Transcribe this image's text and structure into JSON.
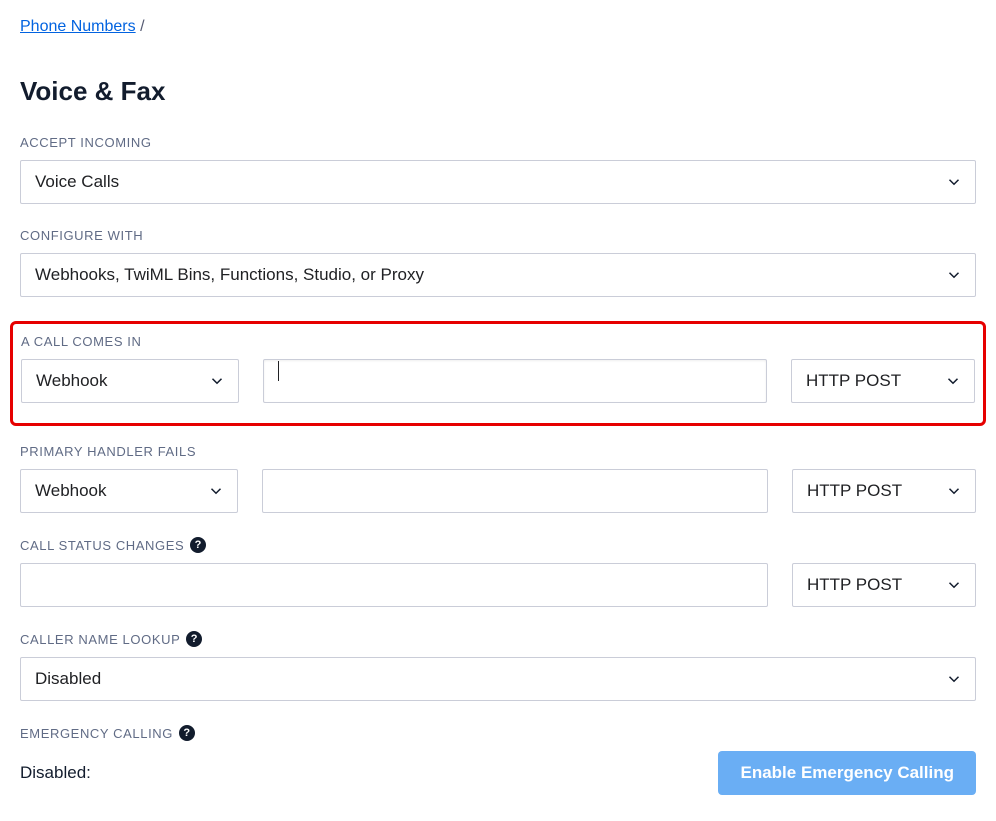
{
  "breadcrumb": {
    "link": "Phone Numbers",
    "separator": "/"
  },
  "title": "Voice & Fax",
  "acceptIncoming": {
    "label": "ACCEPT INCOMING",
    "value": "Voice Calls"
  },
  "configureWith": {
    "label": "CONFIGURE WITH",
    "value": "Webhooks, TwiML Bins, Functions, Studio, or Proxy"
  },
  "callComesIn": {
    "label": "A CALL COMES IN",
    "type": "Webhook",
    "url": "",
    "method": "HTTP POST"
  },
  "primaryFails": {
    "label": "PRIMARY HANDLER FAILS",
    "type": "Webhook",
    "url": "",
    "method": "HTTP POST"
  },
  "statusChanges": {
    "label": "CALL STATUS CHANGES",
    "url": "",
    "method": "HTTP POST"
  },
  "callerLookup": {
    "label": "CALLER NAME LOOKUP",
    "value": "Disabled"
  },
  "emergency": {
    "label": "EMERGENCY CALLING",
    "status": "Disabled:",
    "button": "Enable Emergency Calling"
  },
  "helpGlyph": "?"
}
